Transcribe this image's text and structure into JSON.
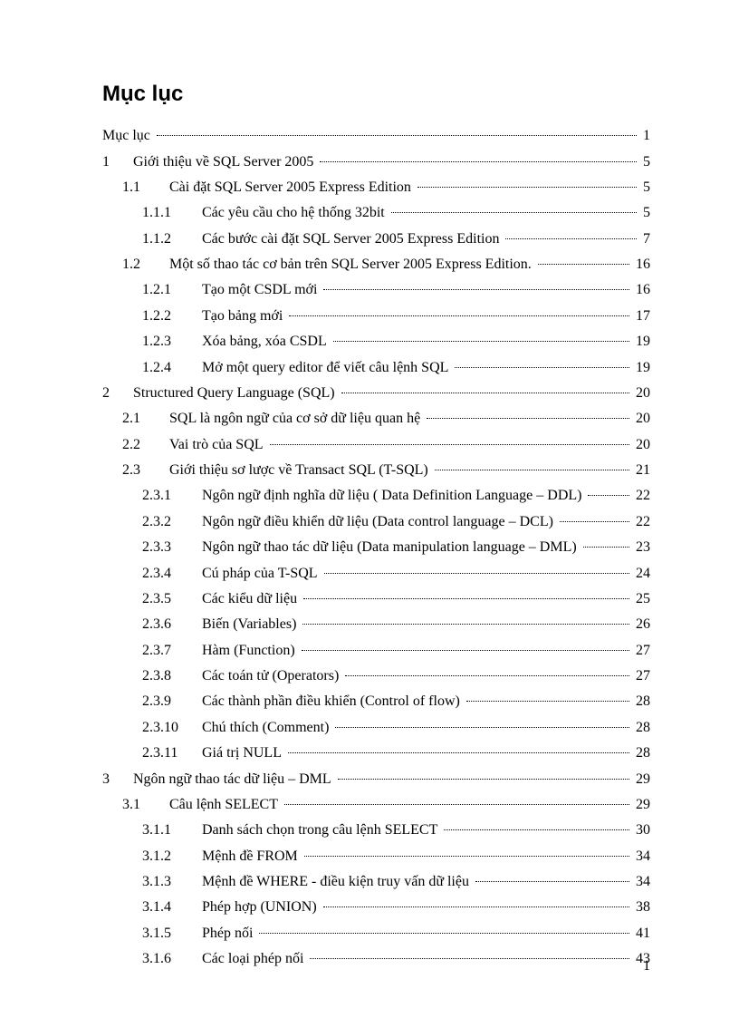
{
  "title": "Mục lục",
  "page_number": "1",
  "entries": [
    {
      "level": 0,
      "num": "",
      "text": "Mục lục",
      "page": "1"
    },
    {
      "level": 1,
      "num": "1",
      "text": "Giới thiệu về SQL Server 2005",
      "page": "5"
    },
    {
      "level": 2,
      "num": "1.1",
      "text": "Cài đặt SQL Server 2005 Express Edition",
      "page": "5"
    },
    {
      "level": 3,
      "num": "1.1.1",
      "text": "Các yêu cầu cho hệ thống 32bit",
      "page": "5"
    },
    {
      "level": 3,
      "num": "1.1.2",
      "text": "Các bước cài đặt SQL Server 2005 Express Edition",
      "page": "7"
    },
    {
      "level": 2,
      "num": "1.2",
      "text": "Một số thao tác cơ bản trên SQL Server 2005 Express Edition.",
      "page": "16"
    },
    {
      "level": 3,
      "num": "1.2.1",
      "text": "Tạo một CSDL mới",
      "page": "16"
    },
    {
      "level": 3,
      "num": "1.2.2",
      "text": "Tạo bảng mới",
      "page": "17"
    },
    {
      "level": 3,
      "num": "1.2.3",
      "text": "Xóa bảng, xóa CSDL",
      "page": "19"
    },
    {
      "level": 3,
      "num": "1.2.4",
      "text": "Mở một query editor để viết câu lệnh SQL",
      "page": "19"
    },
    {
      "level": 1,
      "num": "2",
      "text": "Structured Query Language (SQL)",
      "page": "20"
    },
    {
      "level": 2,
      "num": "2.1",
      "text": "SQL là ngôn ngữ của cơ sở dữ liệu quan hệ",
      "page": "20"
    },
    {
      "level": 2,
      "num": "2.2",
      "text": "Vai trò của SQL",
      "page": "20"
    },
    {
      "level": 2,
      "num": "2.3",
      "text": "Giới thiệu sơ lược về Transact SQL (T-SQL)",
      "page": "21"
    },
    {
      "level": 3,
      "num": "2.3.1",
      "text": "Ngôn ngữ định nghĩa dữ liệu ( Data Definition Language – DDL)",
      "page": "22"
    },
    {
      "level": 3,
      "num": "2.3.2",
      "text": "Ngôn ngữ điều khiển dữ liệu (Data control language – DCL)",
      "page": "22"
    },
    {
      "level": 3,
      "num": "2.3.3",
      "text": "Ngôn ngữ thao tác dữ liệu (Data manipulation language – DML)",
      "page": "23"
    },
    {
      "level": 3,
      "num": "2.3.4",
      "text": "Cú pháp của T-SQL",
      "page": "24"
    },
    {
      "level": 3,
      "num": "2.3.5",
      "text": "Các kiểu dữ liệu",
      "page": "25"
    },
    {
      "level": 3,
      "num": "2.3.6",
      "text": "Biến (Variables)",
      "page": "26"
    },
    {
      "level": 3,
      "num": "2.3.7",
      "text": "Hàm (Function)",
      "page": "27"
    },
    {
      "level": 3,
      "num": "2.3.8",
      "text": "Các toán tử (Operators)",
      "page": "27"
    },
    {
      "level": 3,
      "num": "2.3.9",
      "text": "Các thành phần điều khiển (Control of flow)",
      "page": "28"
    },
    {
      "level": 3,
      "num": "2.3.10",
      "text": "Chú thích (Comment)",
      "page": "28"
    },
    {
      "level": 3,
      "num": "2.3.11",
      "text": "Giá trị NULL",
      "page": "28"
    },
    {
      "level": 1,
      "num": "3",
      "text": "Ngôn ngữ thao tác dữ liệu – DML",
      "page": "29"
    },
    {
      "level": 2,
      "num": "3.1",
      "text": "Câu lệnh SELECT",
      "page": "29"
    },
    {
      "level": 3,
      "num": "3.1.1",
      "text": "Danh sách chọn trong câu lệnh SELECT",
      "page": "30"
    },
    {
      "level": 3,
      "num": "3.1.2",
      "text": "Mệnh đề FROM",
      "page": "34"
    },
    {
      "level": 3,
      "num": "3.1.3",
      "text": "Mệnh đề WHERE -  điều kiện truy vấn dữ liệu",
      "page": "34"
    },
    {
      "level": 3,
      "num": "3.1.4",
      "text": "Phép hợp (UNION)",
      "page": "38"
    },
    {
      "level": 3,
      "num": "3.1.5",
      "text": "Phép nối",
      "page": "41"
    },
    {
      "level": 3,
      "num": "3.1.6",
      "text": "Các loại phép nối",
      "page": "43"
    }
  ]
}
